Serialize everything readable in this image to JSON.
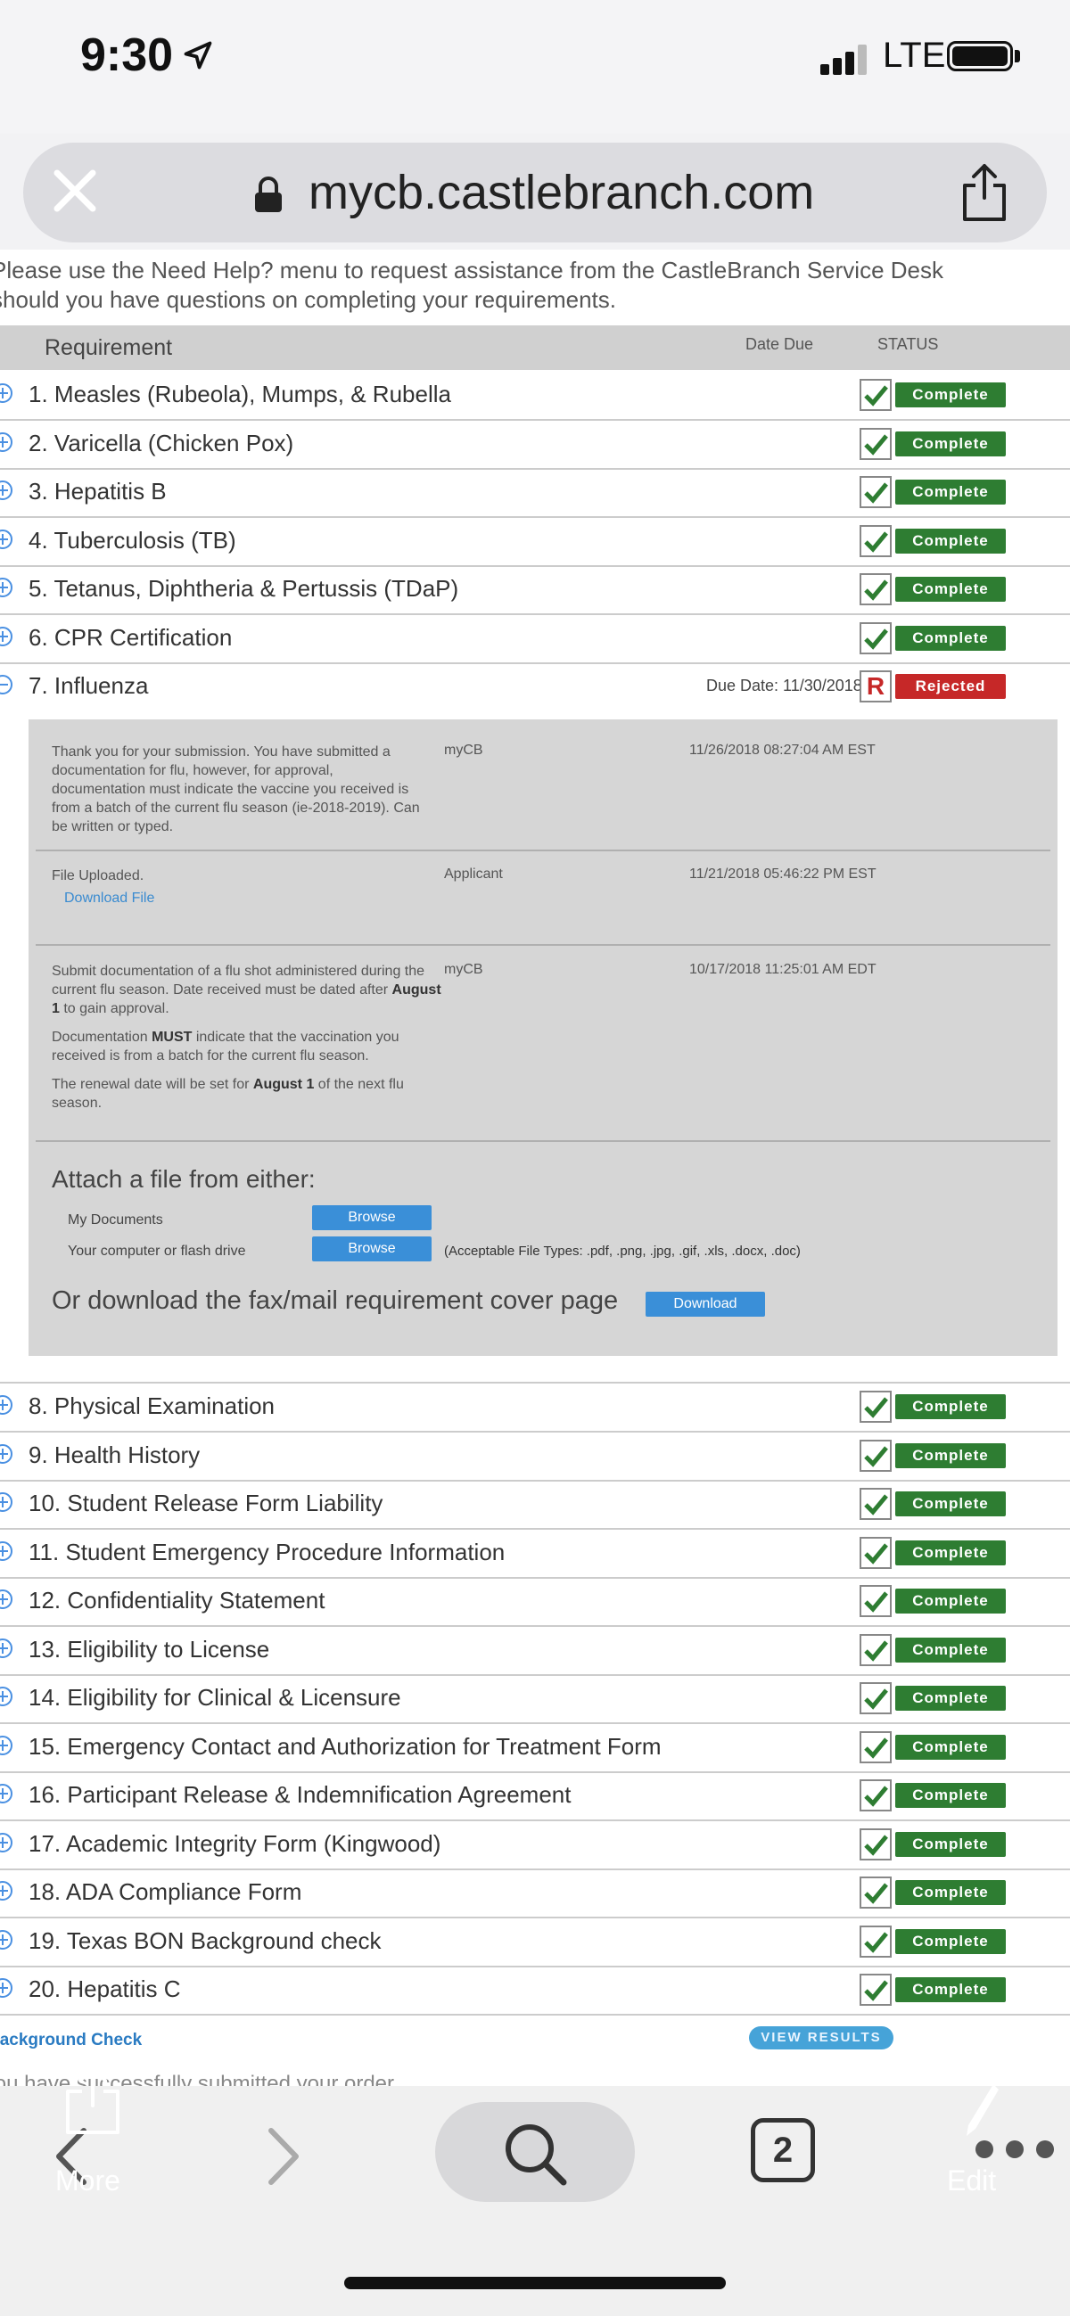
{
  "status_bar": {
    "time": "9:30",
    "network": "LTE"
  },
  "browser": {
    "url": "mycb.castlebranch.com"
  },
  "intro_lines": [
    "Please use the Need Help? menu to request assistance from the CastleBranch Service Desk",
    "should you have questions on completing your requirements."
  ],
  "table_headers": {
    "requirement": "Requirement",
    "date_due": "Date Due",
    "status": "STATUS"
  },
  "requirements_top": [
    {
      "label": "1. Measles (Rubeola), Mumps, & Rubella",
      "status": "Complete"
    },
    {
      "label": "2. Varicella (Chicken Pox)",
      "status": "Complete"
    },
    {
      "label": "3. Hepatitis B",
      "status": "Complete"
    },
    {
      "label": "4. Tuberculosis (TB)",
      "status": "Complete"
    },
    {
      "label": "5. Tetanus, Diphtheria & Pertussis (TDaP)",
      "status": "Complete"
    },
    {
      "label": "6. CPR Certification",
      "status": "Complete"
    }
  ],
  "influenza": {
    "label": "7. Influenza",
    "due_date": "Due Date: 11/30/2018",
    "status": "Rejected",
    "status_letter": "R",
    "history": [
      {
        "text": "Thank you for your submission. You have submitted a documentation for flu, however, for approval, documentation must indicate the vaccine you received is from a batch of the current flu season (ie-2018-2019). Can be written or typed.",
        "by": "myCB",
        "when": "11/26/2018 08:27:04 AM EST"
      },
      {
        "text": "File Uploaded.",
        "link": "Download File",
        "by": "Applicant",
        "when": "11/21/2018 05:46:22 PM EST"
      },
      {
        "p1_a": "Submit documentation of a flu shot administered during the current flu season. Date received must be dated after ",
        "p1_b": "August 1",
        "p1_c": " to gain approval.",
        "p2_a": "Documentation ",
        "p2_b": "MUST",
        "p2_c": " indicate that the vaccination you received is from a batch for the current flu season.",
        "p3_a": "The renewal date will be set for ",
        "p3_b": "August 1",
        "p3_c": " of the next flu season.",
        "by": "myCB",
        "when": "10/17/2018 11:25:01 AM EDT"
      }
    ],
    "attach_title": "Attach a file from either:",
    "my_documents": "My Documents",
    "computer_drive": "Your computer or flash drive",
    "browse_label": "Browse",
    "file_types": "(Acceptable File Types: .pdf, .png, .jpg, .gif, .xls, .docx, .doc)",
    "fax_text": "Or download the fax/mail requirement cover page",
    "download_label": "Download"
  },
  "requirements_bottom": [
    {
      "label": "8. Physical Examination",
      "status": "Complete"
    },
    {
      "label": "9. Health History",
      "status": "Complete"
    },
    {
      "label": "10. Student Release Form Liability",
      "status": "Complete"
    },
    {
      "label": "11. Student Emergency Procedure Information",
      "status": "Complete"
    },
    {
      "label": "12. Confidentiality Statement",
      "status": "Complete"
    },
    {
      "label": "13. Eligibility to License",
      "status": "Complete"
    },
    {
      "label": "14. Eligibility for Clinical & Licensure",
      "status": "Complete"
    },
    {
      "label": "15. Emergency Contact and Authorization for Treatment Form",
      "status": "Complete"
    },
    {
      "label": "16. Participant Release & Indemnification Agreement",
      "status": "Complete"
    },
    {
      "label": "17. Academic Integrity Form (Kingwood)",
      "status": "Complete"
    },
    {
      "label": "18. ADA Compliance Form",
      "status": "Complete"
    },
    {
      "label": "19. Texas BON Background check",
      "status": "Complete"
    },
    {
      "label": "20. Hepatitis C",
      "status": "Complete"
    }
  ],
  "background_check": {
    "label": "Background Check",
    "button": "VIEW RESULTS",
    "subtext": "You have successfully submitted your order"
  },
  "toolbar": {
    "more_label": "More",
    "tab_count": "2",
    "edit_label": "Edit"
  },
  "colors": {
    "complete": "#2e7d32",
    "rejected": "#c62828",
    "link": "#3a8bd0",
    "panel": "#d6d6d6"
  }
}
